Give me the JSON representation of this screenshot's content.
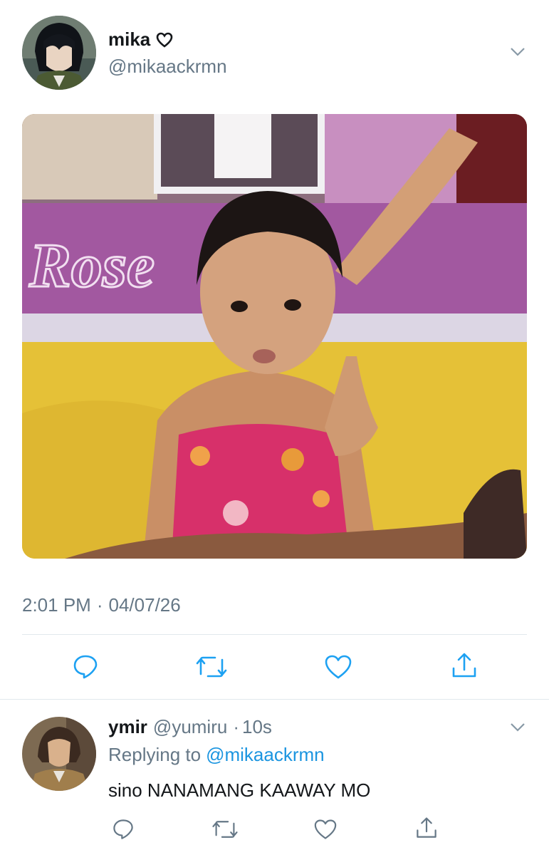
{
  "main_tweet": {
    "display_name": "mika",
    "name_badge": "heart-outline-icon",
    "handle": "@mikaackrmn",
    "banner_text": "Rose",
    "time": "2:01 PM",
    "separator": "·",
    "date": "04/07/26"
  },
  "reply": {
    "display_name": "ymir",
    "handle": "@yumiru",
    "separator": "·",
    "age": "10s",
    "replying_prefix": "Replying to",
    "replying_to": "@mikaackrmn",
    "text": "sino NANAMANG KAAWAY MO"
  },
  "action_icons": [
    "reply-icon",
    "retweet-icon",
    "like-icon",
    "share-icon"
  ],
  "colors": {
    "text": "#14171a",
    "secondary": "#657786",
    "link": "#1b95e0",
    "divider": "#e1e8ed",
    "icon": "#1da1f2"
  }
}
